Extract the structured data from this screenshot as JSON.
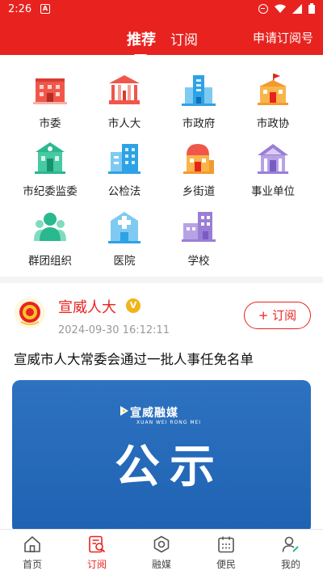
{
  "status_bar": {
    "time": "2:26",
    "left_icon": "notification-a-icon",
    "right_icons": [
      "do-not-disturb-icon",
      "wifi-icon",
      "signal-icon",
      "battery-icon"
    ]
  },
  "header": {
    "tabs": [
      {
        "label": "推荐",
        "active": true
      },
      {
        "label": "订阅",
        "active": false
      }
    ],
    "apply_label": "申请订阅号"
  },
  "categories": [
    {
      "label": "市委",
      "icon": "building-icon"
    },
    {
      "label": "市人大",
      "icon": "hall-icon"
    },
    {
      "label": "市政府",
      "icon": "government-icon"
    },
    {
      "label": "市政协",
      "icon": "flag-building-icon"
    },
    {
      "label": "市纪委监委",
      "icon": "house-icon"
    },
    {
      "label": "公检法",
      "icon": "office-icon"
    },
    {
      "label": "乡街道",
      "icon": "town-icon"
    },
    {
      "label": "事业单位",
      "icon": "institution-icon"
    },
    {
      "label": "群团组织",
      "icon": "group-icon"
    },
    {
      "label": "医院",
      "icon": "hospital-icon"
    },
    {
      "label": "学校",
      "icon": "school-icon"
    }
  ],
  "post": {
    "source": "宣威人大",
    "verified_badge": "V",
    "date": "2024-09-30 16:12:11",
    "subscribe_label": "+ 订阅",
    "headline": "宣威市人大常委会通过一批人事任免名单",
    "banner": {
      "brand": "宣威融媒",
      "brand_sub": "XUAN WEI RONG MEI",
      "notice": "公示"
    }
  },
  "tab_bar": [
    {
      "label": "首页",
      "icon": "home-icon",
      "active": false
    },
    {
      "label": "订阅",
      "icon": "subscribe-icon",
      "active": true
    },
    {
      "label": "融媒",
      "icon": "media-icon",
      "active": false
    },
    {
      "label": "便民",
      "icon": "calendar-icon",
      "active": false
    },
    {
      "label": "我的",
      "icon": "profile-icon",
      "active": false
    }
  ],
  "colors": {
    "brand_red": "#e8231f",
    "icon_red": "#f0574a",
    "icon_teal": "#2ab88e",
    "icon_blue": "#2ea2e6",
    "icon_orange": "#f39a2e",
    "icon_purple": "#9a7ed6"
  }
}
